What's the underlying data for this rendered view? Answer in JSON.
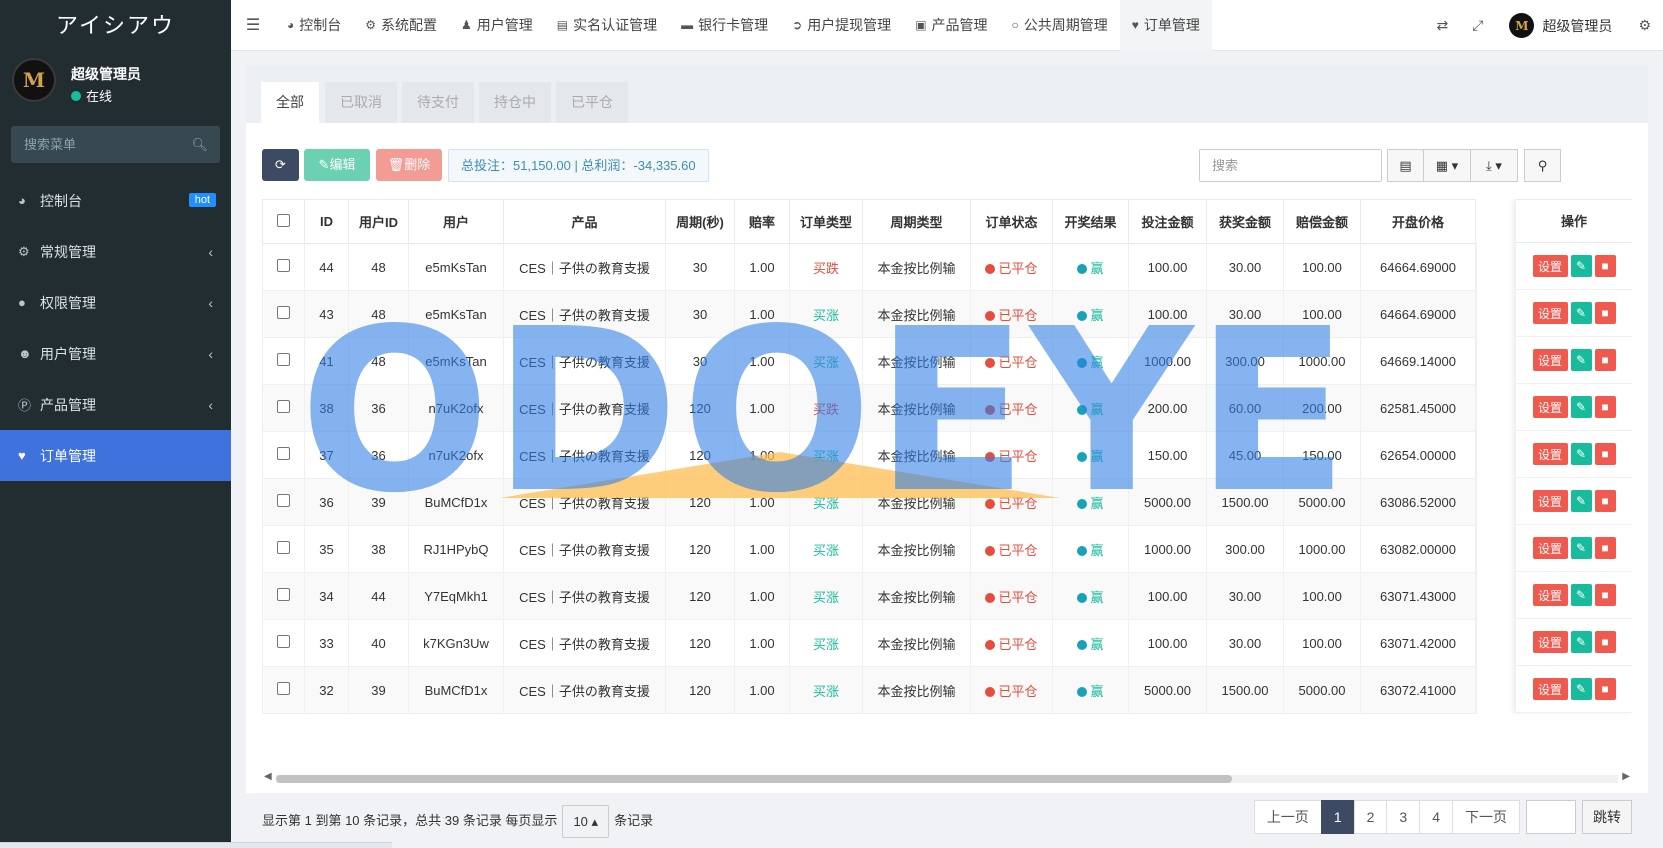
{
  "sidebar": {
    "app_title": "アイシアウ",
    "user_name": "超级管理员",
    "user_status": "在线",
    "search_placeholder": "搜索菜单",
    "items": [
      {
        "label": "控制台",
        "icon": "dashboard-icon",
        "badge": "hot"
      },
      {
        "label": "常规管理",
        "icon": "cogs-icon"
      },
      {
        "label": "权限管理",
        "icon": "users-icon"
      },
      {
        "label": "用户管理",
        "icon": "user-circle-icon"
      },
      {
        "label": "产品管理",
        "icon": "product-icon"
      },
      {
        "label": "订单管理",
        "icon": "heartbeat-icon",
        "active": true
      }
    ]
  },
  "topnav": {
    "tabs": [
      {
        "label": "控制台",
        "icon": "dashboard-icon"
      },
      {
        "label": "系统配置",
        "icon": "gear-icon"
      },
      {
        "label": "用户管理",
        "icon": "user-icon"
      },
      {
        "label": "实名认证管理",
        "icon": "id-card-icon"
      },
      {
        "label": "银行卡管理",
        "icon": "credit-card-icon"
      },
      {
        "label": "用户提现管理",
        "icon": "sign-out-icon"
      },
      {
        "label": "产品管理",
        "icon": "shopping-bag-icon"
      },
      {
        "label": "公共周期管理",
        "icon": "circle-icon"
      },
      {
        "label": "订单管理",
        "icon": "heartbeat-icon",
        "active": true
      }
    ],
    "user_name": "超级管理员"
  },
  "status_tabs": [
    "全部",
    "已取消",
    "待支付",
    "持仓中",
    "已平仓"
  ],
  "toolbar": {
    "edit_label": "编辑",
    "delete_label": "删除",
    "summary": "总投注：51,150.00 | 总利润：-34,335.60",
    "search_placeholder": "搜索"
  },
  "table": {
    "columns": [
      "ID",
      "用户ID",
      "用户",
      "产品",
      "周期(秒)",
      "赔率",
      "订单类型",
      "周期类型",
      "订单状态",
      "开奖结果",
      "投注金额",
      "获奖金额",
      "赔偿金额",
      "开盘价格"
    ],
    "op_header": "操作",
    "op_labels": {
      "set": "设置"
    },
    "rows": [
      {
        "id": "44",
        "uid": "48",
        "user": "e5mKsTan",
        "product": "CES｜子供の教育支援",
        "period": "30",
        "odds": "1.00",
        "type": "买跌",
        "ptype": "本金按比例输",
        "status": "已平仓",
        "result": "赢",
        "bet": "100.00",
        "win": "30.00",
        "comp": "100.00",
        "open": "64664.69000"
      },
      {
        "id": "43",
        "uid": "48",
        "user": "e5mKsTan",
        "product": "CES｜子供の教育支援",
        "period": "30",
        "odds": "1.00",
        "type": "买涨",
        "ptype": "本金按比例输",
        "status": "已平仓",
        "result": "赢",
        "bet": "100.00",
        "win": "30.00",
        "comp": "100.00",
        "open": "64664.69000"
      },
      {
        "id": "41",
        "uid": "48",
        "user": "e5mKsTan",
        "product": "CES｜子供の教育支援",
        "period": "30",
        "odds": "1.00",
        "type": "买涨",
        "ptype": "本金按比例输",
        "status": "已平仓",
        "result": "赢",
        "bet": "1000.00",
        "win": "300.00",
        "comp": "1000.00",
        "open": "64669.14000"
      },
      {
        "id": "38",
        "uid": "36",
        "user": "n7uK2ofx",
        "product": "CES｜子供の教育支援",
        "period": "120",
        "odds": "1.00",
        "type": "买跌",
        "ptype": "本金按比例输",
        "status": "已平仓",
        "result": "赢",
        "bet": "200.00",
        "win": "60.00",
        "comp": "200.00",
        "open": "62581.45000"
      },
      {
        "id": "37",
        "uid": "36",
        "user": "n7uK2ofx",
        "product": "CES｜子供の教育支援",
        "period": "120",
        "odds": "1.00",
        "type": "买涨",
        "ptype": "本金按比例输",
        "status": "已平仓",
        "result": "赢",
        "bet": "150.00",
        "win": "45.00",
        "comp": "150.00",
        "open": "62654.00000"
      },
      {
        "id": "36",
        "uid": "39",
        "user": "BuMCfD1x",
        "product": "CES｜子供の教育支援",
        "period": "120",
        "odds": "1.00",
        "type": "买涨",
        "ptype": "本金按比例输",
        "status": "已平仓",
        "result": "赢",
        "bet": "5000.00",
        "win": "1500.00",
        "comp": "5000.00",
        "open": "63086.52000"
      },
      {
        "id": "35",
        "uid": "38",
        "user": "RJ1HPybQ",
        "product": "CES｜子供の教育支援",
        "period": "120",
        "odds": "1.00",
        "type": "买涨",
        "ptype": "本金按比例输",
        "status": "已平仓",
        "result": "赢",
        "bet": "1000.00",
        "win": "300.00",
        "comp": "1000.00",
        "open": "63082.00000"
      },
      {
        "id": "34",
        "uid": "44",
        "user": "Y7EqMkh1",
        "product": "CES｜子供の教育支援",
        "period": "120",
        "odds": "1.00",
        "type": "买涨",
        "ptype": "本金按比例输",
        "status": "已平仓",
        "result": "赢",
        "bet": "100.00",
        "win": "30.00",
        "comp": "100.00",
        "open": "63071.43000"
      },
      {
        "id": "33",
        "uid": "40",
        "user": "k7KGn3Uw",
        "product": "CES｜子供の教育支援",
        "period": "120",
        "odds": "1.00",
        "type": "买涨",
        "ptype": "本金按比例输",
        "status": "已平仓",
        "result": "赢",
        "bet": "100.00",
        "win": "30.00",
        "comp": "100.00",
        "open": "63071.42000"
      },
      {
        "id": "32",
        "uid": "39",
        "user": "BuMCfD1x",
        "product": "CES｜子供の教育支援",
        "period": "120",
        "odds": "1.00",
        "type": "买涨",
        "ptype": "本金按比例输",
        "status": "已平仓",
        "result": "赢",
        "bet": "5000.00",
        "win": "1500.00",
        "comp": "5000.00",
        "open": "63072.41000"
      }
    ]
  },
  "pagination": {
    "info_prefix": "显示第 1 到第 10 条记录，总共 39 条记录 每页显示",
    "page_size": "10",
    "info_suffix": "条记录",
    "prev": "上一页",
    "pages": [
      "1",
      "2",
      "3",
      "4"
    ],
    "current": "1",
    "next": "下一页",
    "jump": "跳转"
  },
  "watermark": "ODOEYE",
  "colors": {
    "sidebar_bg": "#222d32",
    "active_menu": "#3f72dd",
    "danger": "#f05a4e",
    "success": "#18bc9c",
    "primary_dark": "#3c4a63"
  }
}
